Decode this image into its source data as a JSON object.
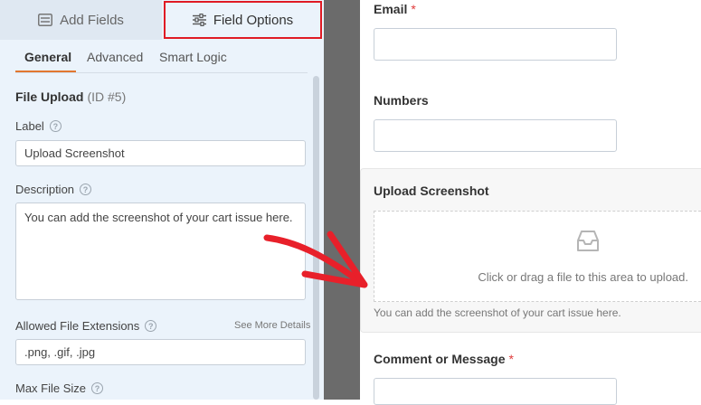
{
  "top_tabs": {
    "add_fields": "Add Fields",
    "field_options": "Field Options"
  },
  "sub_tabs": {
    "general": "General",
    "advanced": "Advanced",
    "smart_logic": "Smart Logic"
  },
  "field": {
    "type": "File Upload",
    "id": "(ID #5)",
    "label_caption": "Label",
    "label_value": "Upload Screenshot",
    "description_caption": "Description",
    "description_value": "You can add the screenshot of your cart issue here.",
    "extensions_caption": "Allowed File Extensions",
    "see_more": "See More Details",
    "extensions_value": ".png, .gif, .jpg",
    "max_size_caption": "Max File Size"
  },
  "help_glyph": "?",
  "preview": {
    "email_label": "Email",
    "numbers_label": "Numbers",
    "upload_label": "Upload Screenshot",
    "drop_text": "Click or drag a file to this area to upload.",
    "upload_description": "You can add the screenshot of your cart issue here.",
    "comment_label": "Comment or Message",
    "required_mark": "*"
  },
  "colors": {
    "highlight_border": "#e01b24",
    "active_underline": "#e27730",
    "arrow": "#e8202a",
    "panel_bg": "#ebf3fb",
    "divider": "#6b6b6b"
  },
  "icons": {
    "add_fields": "list-icon",
    "field_options": "sliders-icon",
    "help": "help-icon",
    "upload": "inbox-icon",
    "annotation": "red-arrow"
  }
}
